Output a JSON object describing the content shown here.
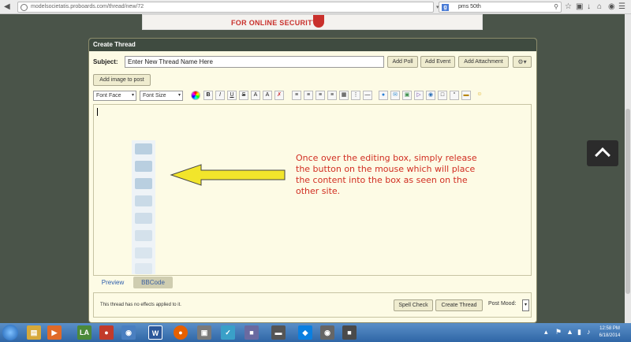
{
  "browser": {
    "url": "modelsocietatis.proboards.com/thread/new/72",
    "search_engine_letter": "g",
    "search_text": "pms 50th"
  },
  "banner": {
    "text": "FOR ONLINE SECURITY"
  },
  "panel": {
    "title": "Create Thread",
    "subject_label": "Subject:",
    "subject_value": "Enter New Thread Name Here",
    "buttons": {
      "add_poll": "Add Poll",
      "add_event": "Add Event",
      "add_attachment": "Add Attachment",
      "add_image": "Add image to post"
    },
    "toolbar": {
      "font_face": "Font Face",
      "font_size": "Font Size",
      "bold": "B",
      "italic": "I",
      "underline": "U",
      "strike": "S",
      "superscript": "A",
      "subscript": "A"
    },
    "instruction": "Once over the editing box, simply release the button on the mouse which will place the content into the box as seen on the other site.",
    "tabs": {
      "preview": "Preview",
      "bbcode": "BBCode"
    },
    "footer": {
      "note": "This thread has no effects applied to it.",
      "spell_check": "Spell Check",
      "create_thread": "Create Thread",
      "post_mood": "Post Mood:"
    }
  },
  "taskbar": {
    "time": "12:58 PM",
    "date": "6/18/2014"
  },
  "colors": {
    "panel_header": "#3f4b40",
    "panel_bg": "#fdfbe5",
    "instruction_text": "#d12e22",
    "arrow_fill": "#f2e52b"
  }
}
